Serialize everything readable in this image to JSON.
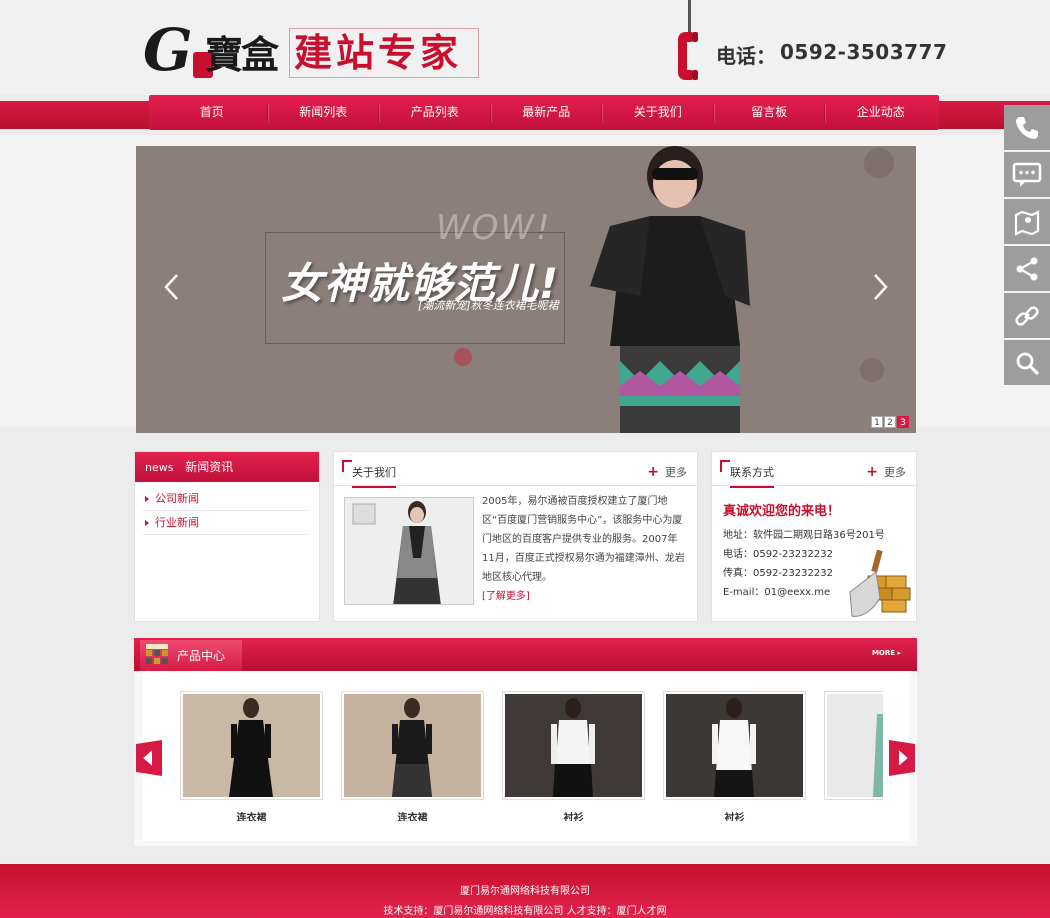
{
  "header": {
    "logo_letter": "G",
    "logo_chinese": "寶盒",
    "logo_tagline": "建站专家",
    "phone_label": "电话：",
    "phone_number": "0592-3503777"
  },
  "nav": {
    "items": [
      "首页",
      "新闻列表",
      "产品列表",
      "最新产品",
      "关于我们",
      "留言板",
      "企业动态"
    ]
  },
  "banner": {
    "wow": "WOW!",
    "headline": "女神就够范儿!",
    "subline": "[潮流新宠]秋冬连衣裙毛呢裙",
    "pager": [
      "1",
      "2",
      "3"
    ],
    "active_page": "3"
  },
  "side_toolbar": {
    "icons": [
      "phone-icon",
      "chat-icon",
      "map-icon",
      "share-icon",
      "link-icon",
      "search-icon"
    ]
  },
  "news": {
    "label_en": "news",
    "label_cn": "新闻资讯",
    "links": [
      "公司新闻",
      "行业新闻"
    ]
  },
  "about": {
    "title": "关于我们",
    "more": "更多",
    "text": "2005年，易尔通被百度授权建立了厦门地区“百度厦门营销服务中心”，该服务中心为厦门地区的百度客户提供专业的服务。2007年11月，百度正式授权易尔通为福建漳州、龙岩地区核心代理。",
    "read_more": "[了解更多]"
  },
  "contact": {
    "title": "联系方式",
    "more": "更多",
    "welcome": "真诚欢迎您的来电！",
    "address": "地址：软件园二期观日路36号201号",
    "phone": "电话：0592-23232232",
    "fax": "传真：0592-23232232",
    "email": "E-mail：01@eexx.me"
  },
  "products": {
    "title": "产品中心",
    "more": "MORE",
    "items": [
      {
        "name": "连衣裙"
      },
      {
        "name": "连衣裙"
      },
      {
        "name": "衬衫"
      },
      {
        "name": "衬衫"
      },
      {
        "name": ""
      }
    ]
  },
  "footer": {
    "line1": "厦门易尔通网络科技有限公司",
    "line2": "技术支持：厦门易尔通网络科技有限公司 人才支持：厦门人才网"
  },
  "colors": {
    "brand_red": "#c8102e",
    "nav_red": "#e61e4d",
    "sidebar_gray": "#9d9d9d"
  }
}
